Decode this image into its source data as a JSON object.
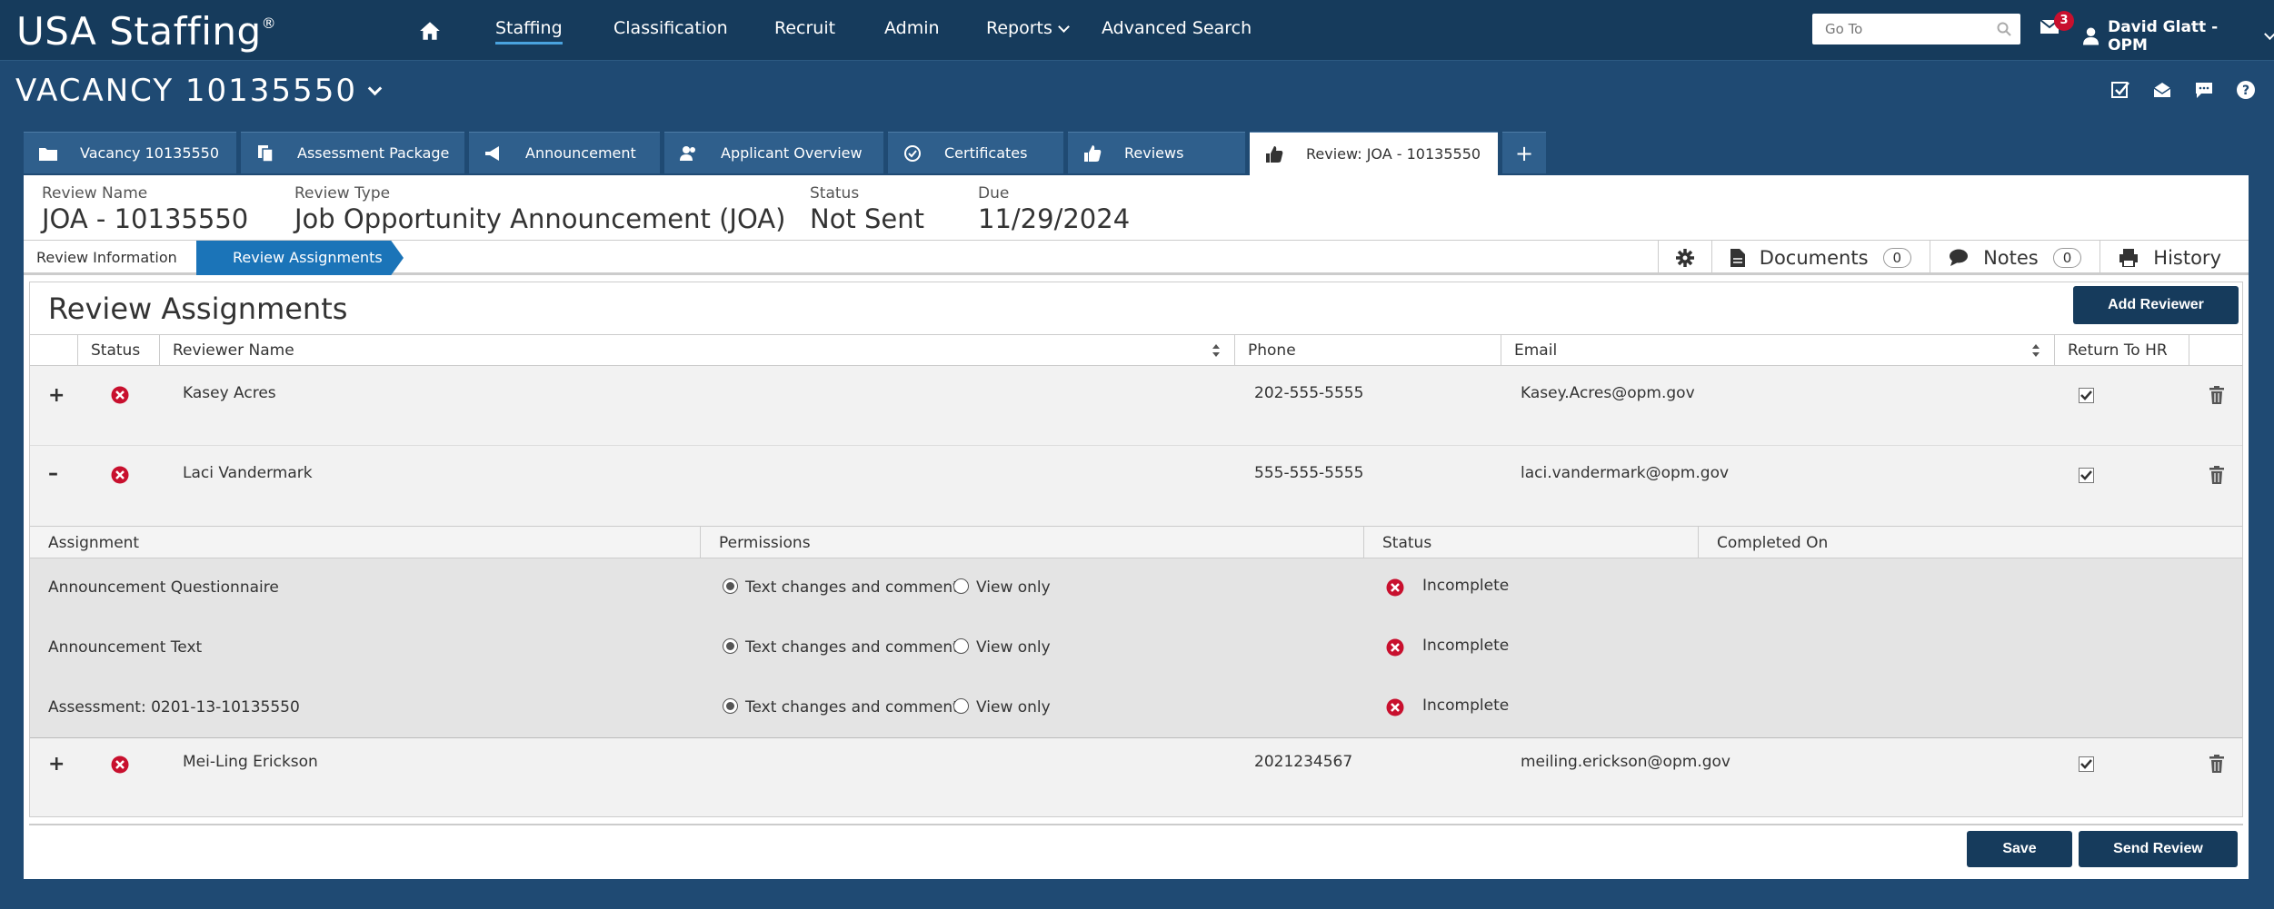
{
  "app": {
    "logo": "USA Staffing",
    "logo_mark": "®"
  },
  "nav": {
    "items": [
      "Staffing",
      "Classification",
      "Recruit",
      "Admin",
      "Reports",
      "Advanced Search"
    ],
    "goto_placeholder": "Go To",
    "mail_count": "3",
    "user": "David Glatt - OPM"
  },
  "vacancy": {
    "title": "VACANCY 10135550"
  },
  "tabs": [
    "Vacancy 10135550",
    "Assessment Package",
    "Announcement",
    "Applicant Overview",
    "Certificates",
    "Reviews",
    "Review: JOA - 10135550",
    "+"
  ],
  "review": {
    "name_label": "Review Name",
    "name": "JOA - 10135550",
    "type_label": "Review Type",
    "type": "Job Opportunity Announcement (JOA)",
    "status_label": "Status",
    "status": "Not Sent",
    "due_label": "Due",
    "due": "11/29/2024"
  },
  "breadcrumb": [
    "Review Information",
    "Review Assignments"
  ],
  "tools": {
    "documents": "Documents",
    "documents_count": "0",
    "notes": "Notes",
    "notes_count": "0",
    "history": "History"
  },
  "section": {
    "title": "Review Assignments",
    "add_reviewer": "Add Reviewer"
  },
  "columns": [
    "Status",
    "Reviewer Name",
    "Phone",
    "Email",
    "Return To HR"
  ],
  "reviewers": [
    {
      "toggle": "+",
      "name": "Kasey Acres",
      "phone": "202-555-5555",
      "email": "Kasey.Acres@opm.gov"
    },
    {
      "toggle": "–",
      "name": "Laci Vandermark",
      "phone": "555-555-5555",
      "email": "laci.vandermark@opm.gov"
    },
    {
      "toggle": "+",
      "name": "Mei-Ling Erickson",
      "phone": "2021234567",
      "email": "meiling.erickson@opm.gov"
    }
  ],
  "sub_columns": [
    "Assignment",
    "Permissions",
    "Status",
    "Completed On"
  ],
  "assignments": [
    {
      "name": "Announcement Questionnaire",
      "perm_a": "Text changes and comments",
      "perm_b": "View only",
      "status": "Incomplete"
    },
    {
      "name": "Announcement Text",
      "perm_a": "Text changes and comments",
      "perm_b": "View only",
      "status": "Incomplete"
    },
    {
      "name": "Assessment: 0201-13-10135550",
      "perm_a": "Text changes and comments",
      "perm_b": "View only",
      "status": "Incomplete"
    }
  ],
  "footer": {
    "save": "Save",
    "send": "Send Review"
  },
  "colors": {
    "nav_bg": "#163b5c",
    "page_bg": "#1f4a73",
    "active_crumb": "#1b74b8",
    "error_red": "#c8102e"
  }
}
